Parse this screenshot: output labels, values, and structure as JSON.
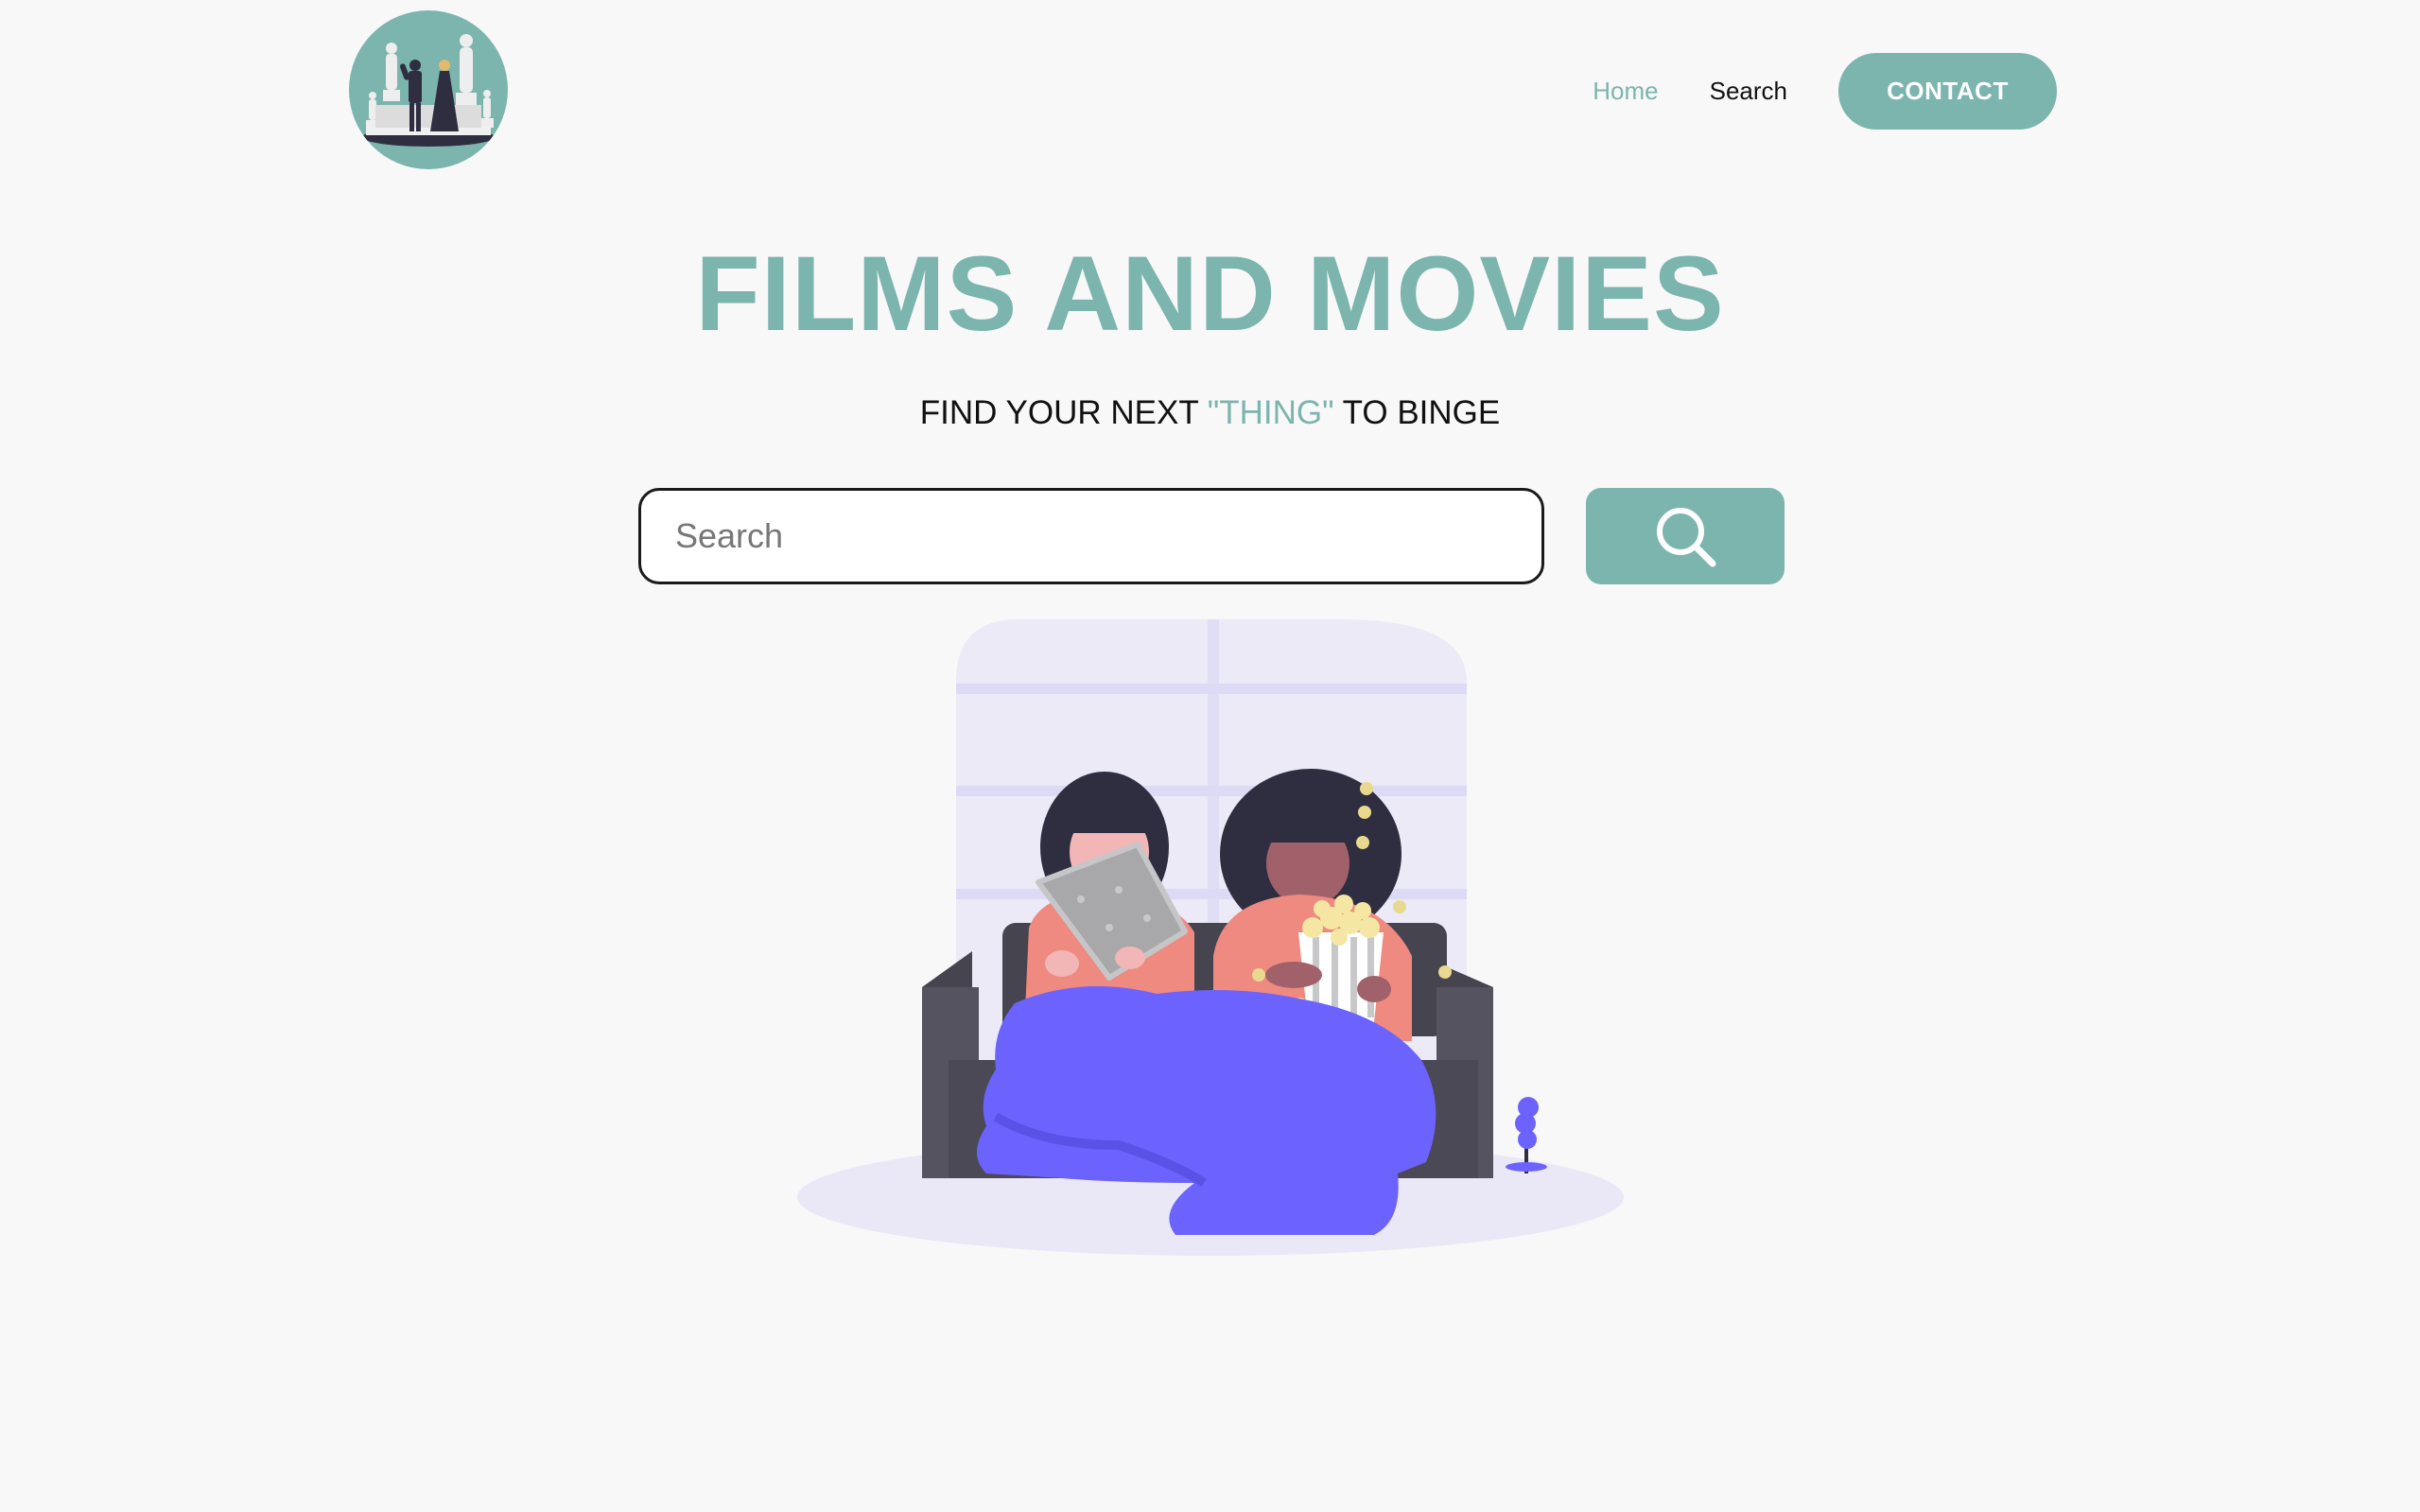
{
  "colors": {
    "accent": "#7bb5ae",
    "text": "#111111",
    "background": "#f8f8f8",
    "blanket": "#6c63ff"
  },
  "header": {
    "logo_icon": "oscar-statues-logo",
    "nav": {
      "home_label": "Home",
      "search_label": "Search",
      "contact_label": "CONTACT"
    }
  },
  "hero": {
    "title": "FILMS AND MOVIES",
    "subtitle_pre": "FIND YOUR NEXT ",
    "subtitle_accent": "\"THING\"",
    "subtitle_post": " TO BINGE"
  },
  "search": {
    "placeholder": "Search",
    "value": "",
    "button_icon": "search-icon"
  },
  "illustration": {
    "icon": "couch-binge-watching-illustration"
  }
}
